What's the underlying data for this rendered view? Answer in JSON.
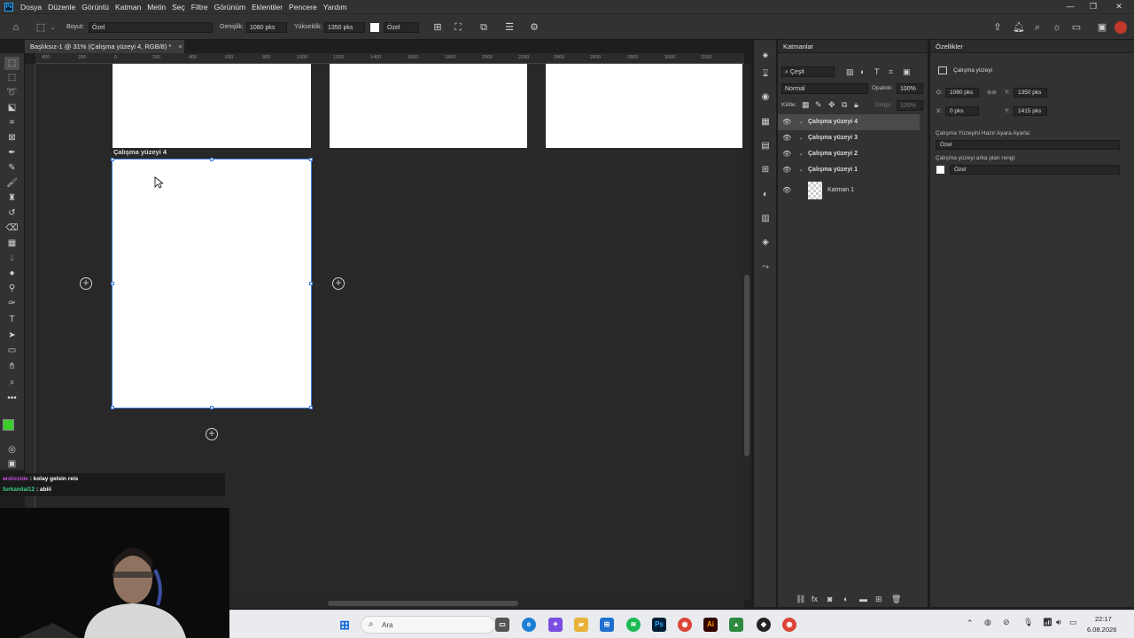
{
  "menu": {
    "app_icon": "Ps",
    "items": [
      "Dosya",
      "Düzenle",
      "Görüntü",
      "Katman",
      "Metin",
      "Seç",
      "Filtre",
      "Görünüm",
      "Eklentiler",
      "Pencere",
      "Yardım"
    ],
    "window_controls": [
      "—",
      "❐",
      "✕"
    ]
  },
  "options": {
    "size_label": "Boyut:",
    "size_value": "Özel",
    "width_label": "Genişlik:",
    "width_value": "1080 pks",
    "height_label": "Yükseklik:",
    "height_value": "1350 pks",
    "color_value": "Özel"
  },
  "document": {
    "tab_title": "Başlıksız-1 @ 31% (Çalışma yüzeyi 4, RGB/8) *",
    "close": "×"
  },
  "ruler": {
    "h_ticks": [
      "400",
      "200",
      "0",
      "200",
      "400",
      "600",
      "800",
      "1000",
      "1200",
      "1400",
      "1600",
      "1800",
      "2000",
      "2200",
      "2400",
      "2600",
      "2800",
      "3000",
      "3200"
    ]
  },
  "canvas": {
    "artboard_label": "Çalışma yüzeyi 4",
    "add_symbol": "+"
  },
  "chat": {
    "lines": [
      {
        "user": "e̶rdioxide",
        "msg": " : kolay gelsin reis",
        "color": "#c24dd6"
      },
      {
        "user": "furkanilal12",
        "msg": " : abiii",
        "color": "#3fd08b"
      }
    ]
  },
  "layers_panel": {
    "title": "Katmanlar",
    "filter": "Çeşit",
    "blend_mode": "Normal",
    "opacity_label": "Opaklık:",
    "opacity_value": "100%",
    "lock_label": "Kilitle:",
    "fill_label": "Dolgu:",
    "fill_value": "100%",
    "layers": [
      {
        "name": "Çalışma yüzeyi 4",
        "selected": true
      },
      {
        "name": "Çalışma yüzeyi 3",
        "selected": false
      },
      {
        "name": "Çalışma yüzeyi 2",
        "selected": false
      },
      {
        "name": "Çalışma yüzeyi 1",
        "selected": false
      }
    ],
    "sublayer": "Katman 1"
  },
  "properties_panel": {
    "title": "Özellikler",
    "type": "Çalışma yüzeyi",
    "w_label": "G:",
    "w_value": "1080 pks",
    "h_label": "Y:",
    "h_value": "1350 pks",
    "x_label": "X:",
    "x_value": "0 pks",
    "y_label": "Y:",
    "y_value": "1415 pks",
    "preset_label": "Çalışma Yüzeyini Hazır Ayara Ayarla:",
    "preset_value": "Özel",
    "bg_label": "Çalışma yüzeyi arka plan rengi:",
    "bg_value": "Özel"
  },
  "taskbar": {
    "search_placeholder": "Ara",
    "time": "22:17",
    "date": "6.08.2026"
  },
  "colors": {
    "foreground": "#3ccc2c",
    "accent": "#31a8ff",
    "selection": "#3b7bd6"
  }
}
